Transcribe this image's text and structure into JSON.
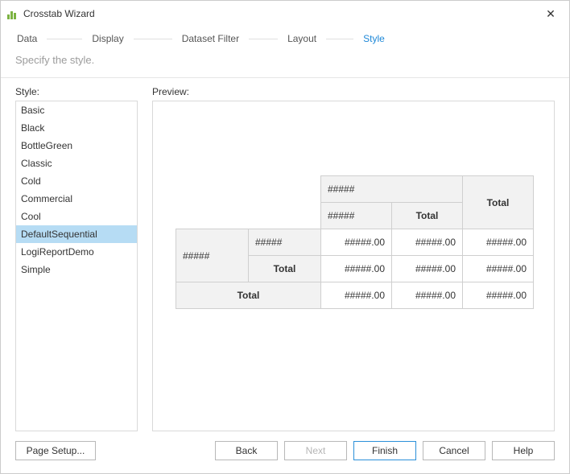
{
  "window": {
    "title": "Crosstab Wizard"
  },
  "steps": {
    "data": "Data",
    "display": "Display",
    "dataset_filter": "Dataset Filter",
    "layout": "Layout",
    "style": "Style"
  },
  "subtitle": "Specify the style.",
  "labels": {
    "style": "Style:",
    "preview": "Preview:"
  },
  "styles": [
    "Basic",
    "Black",
    "BottleGreen",
    "Classic",
    "Cold",
    "Commercial",
    "Cool",
    "DefaultSequential",
    "LogiReportDemo",
    "Simple"
  ],
  "selected_style_index": 7,
  "crosstab": {
    "col_group_placeholder": "#####",
    "col_placeholder": "#####",
    "total_label": "Total",
    "row_group_placeholder": "#####",
    "row_placeholder": "#####",
    "value_placeholder": "#####.00"
  },
  "buttons": {
    "page_setup": "Page Setup...",
    "back": "Back",
    "next": "Next",
    "finish": "Finish",
    "cancel": "Cancel",
    "help": "Help"
  }
}
